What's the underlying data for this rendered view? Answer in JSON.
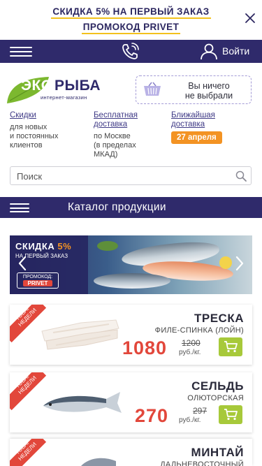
{
  "promo": {
    "line1": "СКИДКА 5% НА ПЕРВЫЙ ЗАКАЗ",
    "line2": "ПРОМОКОД PRIVET"
  },
  "topbar": {
    "login_label": "Войти"
  },
  "logo": {
    "part1": "ЭКО",
    "part2": "РЫБА",
    "subtitle": "интернет-магазин"
  },
  "cart": {
    "line1": "Вы ничего",
    "line2": "не выбрали"
  },
  "info": [
    {
      "head": "Скидки",
      "body": [
        "для новых",
        "и постоянных",
        "клиентов"
      ]
    },
    {
      "head": "Бесплатная доставка",
      "body": [
        "по Москве",
        "(в пределах",
        "МКАД)"
      ]
    },
    {
      "head": "Ближайшая доставка",
      "badge": "27 апреля"
    }
  ],
  "search": {
    "placeholder": "Поиск"
  },
  "catalog": {
    "title": "Каталог продукции"
  },
  "banner": {
    "title": "СКИДКА",
    "percent": "5%",
    "subtitle": "НА ПЕРВЫЙ ЗАКАЗ",
    "code_label": "ПРОМОКОД:",
    "code": "PRIVET"
  },
  "products": [
    {
      "ribbon": "ТОВАР НЕДЕЛИ",
      "name": "ТРЕСКА",
      "sub": "ФИЛЕ-СПИНКА (ЛОЙН)",
      "price": "1080",
      "old_price": "1200",
      "unit": "руб./кг."
    },
    {
      "ribbon": "ТОВАР НЕДЕЛИ",
      "name": "СЕЛЬДЬ",
      "sub": "ОЛЮТОРСКАЯ",
      "price": "270",
      "old_price": "297",
      "unit": "руб./кг."
    },
    {
      "ribbon": "ТОВАР НЕДЕЛИ",
      "name": "МИНТАЙ",
      "sub": "ДАЛЬНЕВОСТОЧНЫЙ",
      "price": "",
      "old_price": "",
      "unit": ""
    }
  ],
  "colors": {
    "brand_navy": "#2f2a6b",
    "accent_orange": "#f39323",
    "price_red": "#e2473b",
    "cart_green": "#a7c93a",
    "logo_green": "#7cb82f",
    "promo_underline": "#f3c11c"
  }
}
